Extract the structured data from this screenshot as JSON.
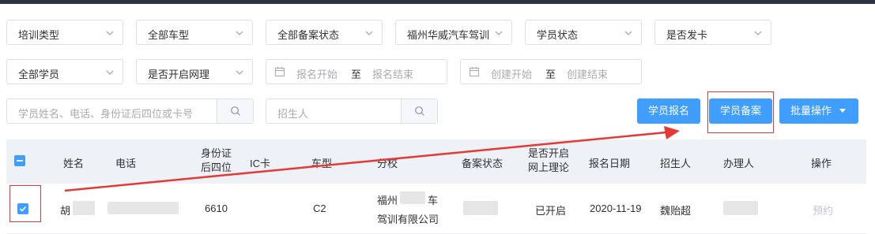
{
  "filters": {
    "row1": [
      {
        "label": "培训类型"
      },
      {
        "label": "全部车型"
      },
      {
        "label": "全部备案状态"
      },
      {
        "label": "福州华威汽车驾训"
      },
      {
        "label": "学员状态"
      },
      {
        "label": "是否发卡"
      }
    ],
    "row2_selects": [
      {
        "label": "全部学员"
      },
      {
        "label": "是否开启网理"
      }
    ],
    "signup_range": {
      "start": "报名开始",
      "sep": "至",
      "end": "报名结束"
    },
    "create_range": {
      "start": "创建开始",
      "sep": "至",
      "end": "创建结束"
    },
    "search_student": {
      "placeholder": "学员姓名、电话、身份证后四位或卡号"
    },
    "search_recruiter": {
      "placeholder": "招生人"
    }
  },
  "actions": {
    "signup": "学员报名",
    "record": "学员备案",
    "batch": "批量操作"
  },
  "table": {
    "headers": {
      "name": "姓名",
      "phone": "电话",
      "id_last4_line1": "身份证",
      "id_last4_line2": "后四位",
      "ic": "IC卡",
      "car": "车型",
      "school": "分校",
      "record_status": "备案状态",
      "online_line1": "是否开启",
      "online_line2": "网上理论",
      "signup_date": "报名日期",
      "recruiter": "招生人",
      "handler": "办理人",
      "ops": "操作"
    },
    "rows": [
      {
        "name": "胡",
        "id_last4": "6610",
        "car": "C2",
        "school_line1": "福州",
        "school_line1_end": "车",
        "school_line2": "驾训有限公司",
        "online": "已开启",
        "signup_date": "2020-11-19",
        "recruiter": "魏贻超",
        "op": "预约"
      }
    ]
  },
  "colors": {
    "primary": "#409eff",
    "annotation": "#e53935",
    "header_bg": "#eef1f6"
  }
}
